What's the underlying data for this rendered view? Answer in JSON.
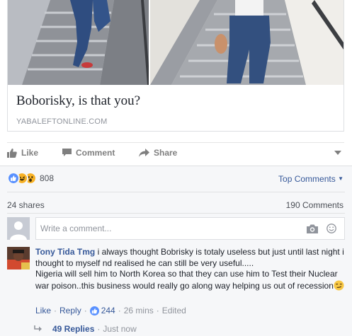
{
  "link_card": {
    "title": "Boborisky, is that you?",
    "domain": "YABALEFTONLINE.COM"
  },
  "actions": {
    "like_label": "Like",
    "comment_label": "Comment",
    "share_label": "Share"
  },
  "reactions": {
    "icons": [
      "like-icon",
      "haha-icon",
      "wow-icon"
    ],
    "count": "808",
    "sort_label": "Top Comments"
  },
  "stats": {
    "shares": "24 shares",
    "comments": "190 Comments"
  },
  "write_comment": {
    "placeholder": "Write a comment..."
  },
  "comment": {
    "author": "Tony Tida Tmg",
    "text": "i always thought Bobrisky is totaly useless but just until last night i thought to myself nd realised he can still be very useful.....",
    "text_line2": "Nigeria will sell him to North Korea so that they can use him to Test their Nuclear war poison..this business would really go along way helping us out of recession",
    "like_label": "Like",
    "reply_label": "Reply",
    "like_count": "244",
    "time": "26 mins",
    "edited": "Edited"
  },
  "replies": {
    "count_label": "49 Replies",
    "time": "Just now"
  },
  "colors": {
    "link_blue": "#365899",
    "like_blue": "#5890ff",
    "muted_gray": "#90949c",
    "feedback_bg": "#f6f7f9"
  }
}
